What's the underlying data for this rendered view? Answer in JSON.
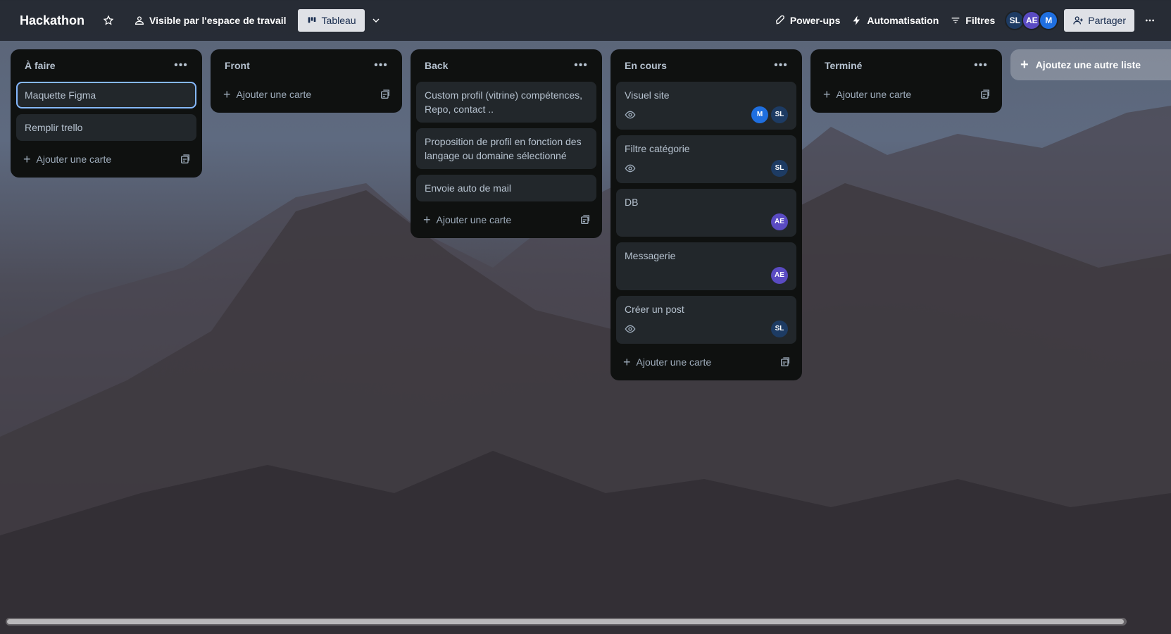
{
  "header": {
    "title": "Hackathon",
    "visibility_label": "Visible par l'espace de travail",
    "view_label": "Tableau",
    "powerups_label": "Power-ups",
    "automation_label": "Automatisation",
    "filters_label": "Filtres",
    "share_label": "Partager",
    "members": [
      "SL",
      "AE",
      "M"
    ]
  },
  "lists": [
    {
      "title": "À faire",
      "cards": [
        {
          "title": "Maquette Figma"
        },
        {
          "title": "Remplir trello"
        }
      ],
      "add_label": "Ajouter une carte"
    },
    {
      "title": "Front",
      "cards": [],
      "add_label": "Ajouter une carte"
    },
    {
      "title": "Back",
      "cards": [
        {
          "title": "Custom profil (vitrine) compétences, Repo, contact .."
        },
        {
          "title": "Proposition de profil en fonction des langage ou domaine sélectionné"
        },
        {
          "title": "Envoie auto de mail"
        }
      ],
      "add_label": "Ajouter une carte"
    },
    {
      "title": "En cours",
      "cards": [
        {
          "title": "Visuel site",
          "members": [
            "M",
            "SL"
          ]
        },
        {
          "title": "Filtre catégorie",
          "members": [
            "SL"
          ]
        },
        {
          "title": "DB",
          "members": [
            "AE"
          ]
        },
        {
          "title": "Messagerie",
          "members": [
            "AE"
          ]
        },
        {
          "title": "Créer un post",
          "members": [
            "SL"
          ]
        }
      ],
      "add_label": "Ajouter une carte"
    },
    {
      "title": "Terminé",
      "cards": [],
      "add_label": "Ajouter une carte"
    }
  ],
  "add_list_label": "Ajoutez une autre liste",
  "colors": {
    "list_bg": "#0f1110",
    "card_bg": "#22272b",
    "focus": "#85b8ff",
    "member_sl": "#1d3b63",
    "member_ae": "#5a4bc2",
    "member_m": "#1f6fe0"
  }
}
